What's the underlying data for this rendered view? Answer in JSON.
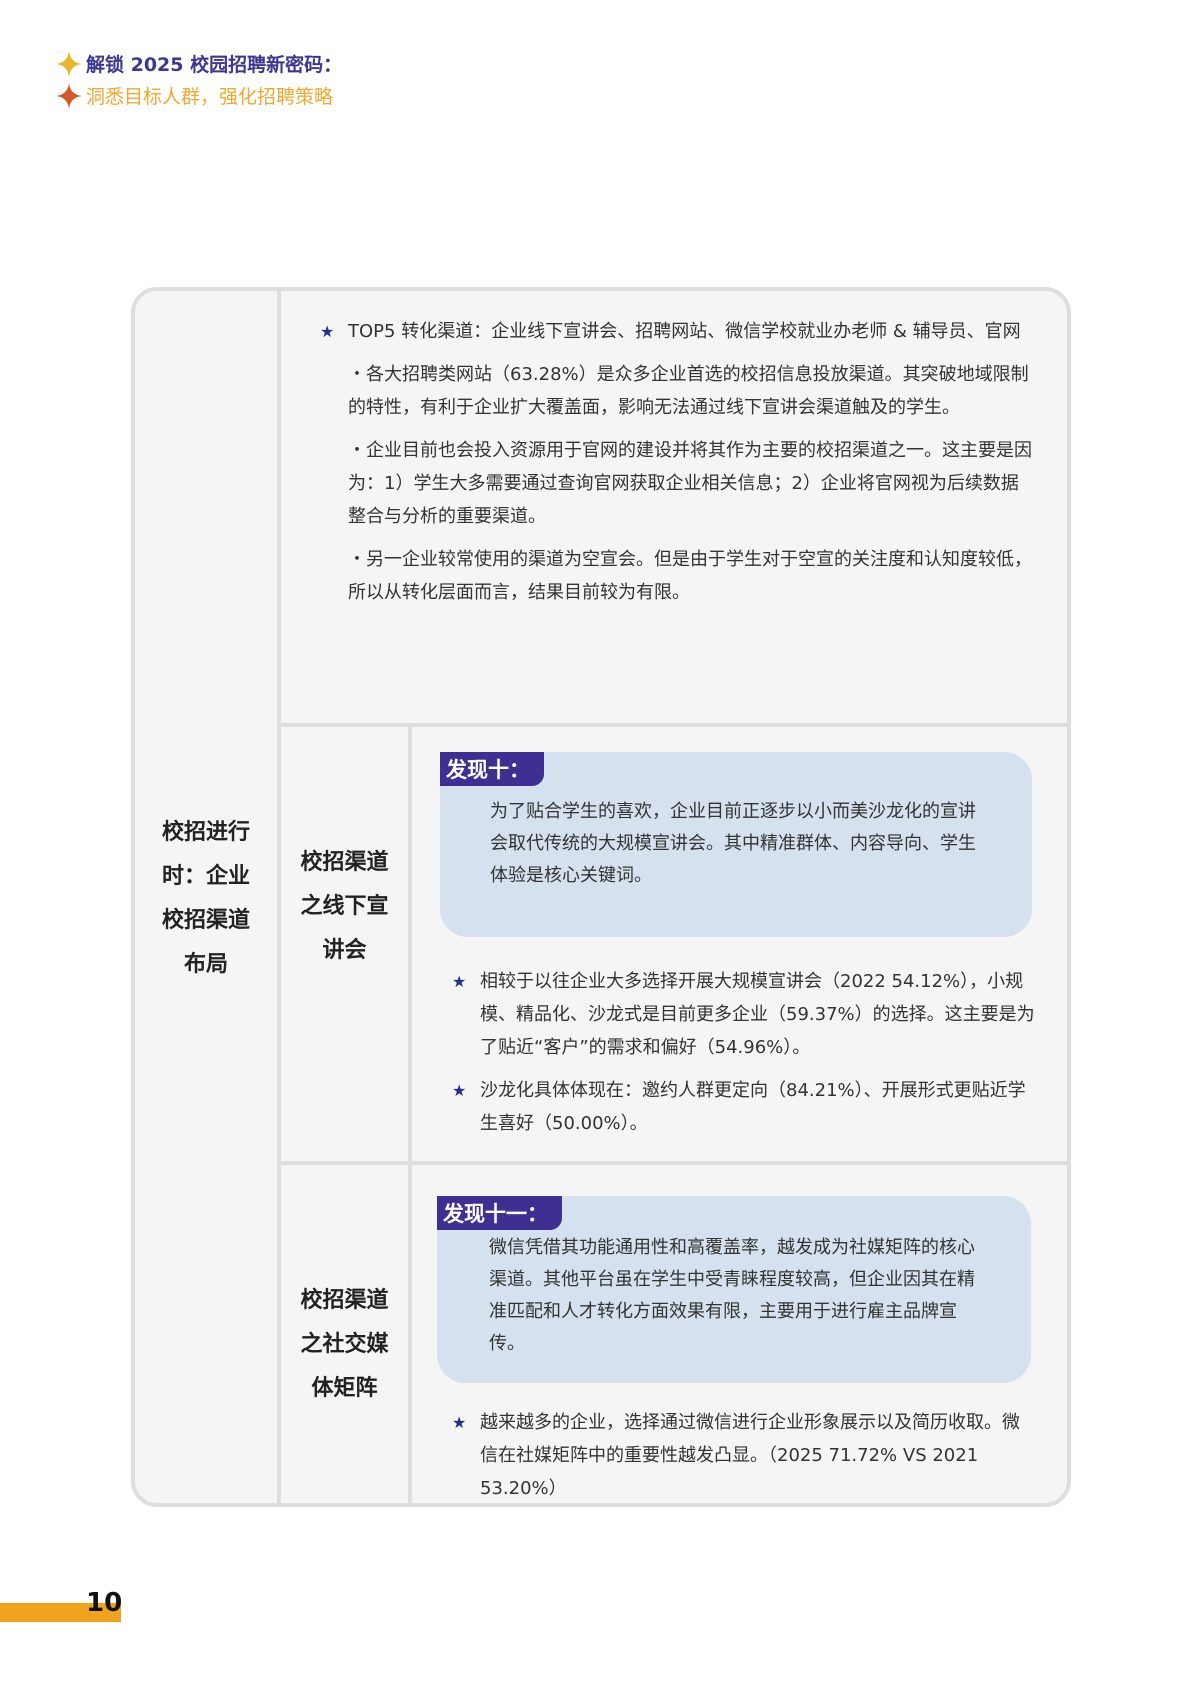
{
  "header": {
    "line1": "解锁 2025 校园招聘新密码：",
    "line2": "洞悉目标人群，强化招聘策略"
  },
  "table": {
    "section_label": "校招进行时：企业校招渠道布局",
    "section_label_lines": [
      "校招进行",
      "时：企业",
      "校招渠道",
      "布局"
    ],
    "row1": {
      "star_item": "TOP5 转化渠道：企业线下宣讲会、招聘网站、微信学校就业办老师 & 辅导员、官网",
      "paragraphs": [
        "・各大招聘类网站（63.28%）是众多企业首选的校招信息投放渠道。其突破地域限制的特性，有利于企业扩大覆盖面，影响无法通过线下宣讲会渠道触及的学生。",
        "・企业目前也会投入资源用于官网的建设并将其作为主要的校招渠道之一。这主要是因为：1）学生大多需要通过查询官网获取企业相关信息；2）企业将官网视为后续数据整合与分析的重要渠道。",
        "・另一企业较常使用的渠道为空宣会。但是由于学生对于空宣的关注度和认知度较低，所以从转化层面而言，结果目前较为有限。"
      ]
    },
    "row2": {
      "label_lines": [
        "校招渠道",
        "之线下宣",
        "讲会"
      ],
      "finding_tag": "发现十：",
      "finding_text": "为了贴合学生的喜欢，企业目前正逐步以小而美沙龙化的宣讲会取代传统的大规模宣讲会。其中精准群体、内容导向、学生体验是核心关键词。",
      "items": [
        "相较于以往企业大多选择开展大规模宣讲会（2022 54.12%），小规模、精品化、沙龙式是目前更多企业（59.37%）的选择。这主要是为了贴近“客户”的需求和偏好（54.96%）。",
        "沙龙化具体体现在：邀约人群更定向（84.21%）、开展形式更贴近学生喜好（50.00%）。"
      ]
    },
    "row3": {
      "label_lines": [
        "校招渠道",
        "之社交媒",
        "体矩阵"
      ],
      "finding_tag": "发现十一：",
      "finding_text": "微信凭借其功能通用性和高覆盖率，越发成为社媒矩阵的核心渠道。其他平台虽在学生中受青睐程度较高，但企业因其在精准匹配和人才转化方面效果有限，主要用于进行雇主品牌宣传。",
      "items": [
        "越来越多的企业，选择通过微信进行企业形象展示以及简历收取。微信在社媒矩阵中的重要性越发凸显。（2025 71.72% VS 2021 53.20%）"
      ]
    }
  },
  "page_number": "10",
  "colors": {
    "purple": "#3f2f92",
    "orange": "#efa31f",
    "star_blue": "#23318c",
    "box_blue": "#d5e1ee"
  },
  "icons": {
    "star": "★"
  }
}
